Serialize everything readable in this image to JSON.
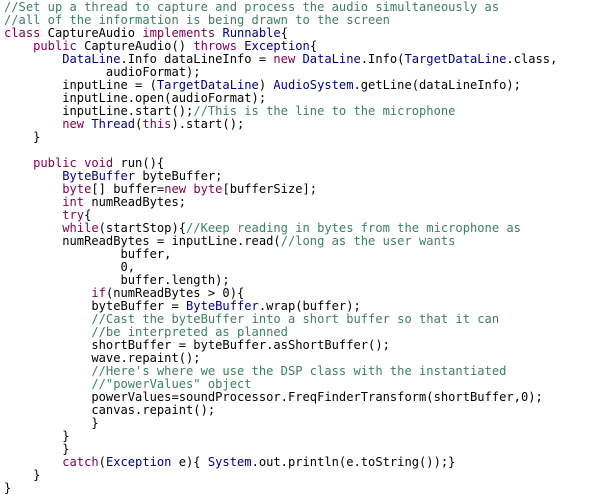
{
  "colors": {
    "background": "#ffffff",
    "plain": "#000000",
    "comment": "#3f7f5f",
    "keyword": "#7f0055",
    "type": "#000080"
  },
  "lines": [
    [
      {
        "s": "c",
        "t": "//Set up a thread to capture and process the audio simultaneously as"
      }
    ],
    [
      {
        "s": "c",
        "t": "//all of the information is being drawn to the screen"
      }
    ],
    [
      {
        "s": "k",
        "t": "class"
      },
      {
        "s": "p",
        "t": " CaptureAudio "
      },
      {
        "s": "k",
        "t": "implements"
      },
      {
        "s": "p",
        "t": " "
      },
      {
        "s": "t",
        "t": "Runnable"
      },
      {
        "s": "p",
        "t": "{"
      }
    ],
    [
      {
        "s": "p",
        "t": "    "
      },
      {
        "s": "k",
        "t": "public"
      },
      {
        "s": "p",
        "t": " CaptureAudio() "
      },
      {
        "s": "k",
        "t": "throws"
      },
      {
        "s": "p",
        "t": " "
      },
      {
        "s": "t",
        "t": "Exception"
      },
      {
        "s": "p",
        "t": "{"
      }
    ],
    [
      {
        "s": "p",
        "t": "        "
      },
      {
        "s": "t",
        "t": "DataLine"
      },
      {
        "s": "p",
        "t": ".Info dataLineInfo = "
      },
      {
        "s": "k",
        "t": "new"
      },
      {
        "s": "p",
        "t": " "
      },
      {
        "s": "t",
        "t": "DataLine"
      },
      {
        "s": "p",
        "t": ".Info("
      },
      {
        "s": "t",
        "t": "TargetDataLine"
      },
      {
        "s": "p",
        "t": ".class,"
      }
    ],
    [
      {
        "s": "p",
        "t": "              audioFormat);"
      }
    ],
    [
      {
        "s": "p",
        "t": "        inputLine = ("
      },
      {
        "s": "t",
        "t": "TargetDataLine"
      },
      {
        "s": "p",
        "t": ") "
      },
      {
        "s": "t",
        "t": "AudioSystem"
      },
      {
        "s": "p",
        "t": ".getLine(dataLineInfo);"
      }
    ],
    [
      {
        "s": "p",
        "t": "        inputLine.open(audioFormat);"
      }
    ],
    [
      {
        "s": "p",
        "t": "        inputLine.start();"
      },
      {
        "s": "c",
        "t": "//This is the line to the microphone"
      }
    ],
    [
      {
        "s": "p",
        "t": "        "
      },
      {
        "s": "k",
        "t": "new"
      },
      {
        "s": "p",
        "t": " "
      },
      {
        "s": "t",
        "t": "Thread"
      },
      {
        "s": "p",
        "t": "("
      },
      {
        "s": "k",
        "t": "this"
      },
      {
        "s": "p",
        "t": ").start();"
      }
    ],
    [
      {
        "s": "p",
        "t": "    }"
      }
    ],
    [
      {
        "s": "p",
        "t": ""
      }
    ],
    [
      {
        "s": "p",
        "t": "    "
      },
      {
        "s": "k",
        "t": "public"
      },
      {
        "s": "p",
        "t": " "
      },
      {
        "s": "k",
        "t": "void"
      },
      {
        "s": "p",
        "t": " run(){"
      }
    ],
    [
      {
        "s": "p",
        "t": "        "
      },
      {
        "s": "t",
        "t": "ByteBuffer"
      },
      {
        "s": "p",
        "t": " byteBuffer;"
      }
    ],
    [
      {
        "s": "p",
        "t": "        "
      },
      {
        "s": "k",
        "t": "byte"
      },
      {
        "s": "p",
        "t": "[] buffer="
      },
      {
        "s": "k",
        "t": "new"
      },
      {
        "s": "p",
        "t": " "
      },
      {
        "s": "k",
        "t": "byte"
      },
      {
        "s": "p",
        "t": "[bufferSize];"
      }
    ],
    [
      {
        "s": "p",
        "t": "        "
      },
      {
        "s": "k",
        "t": "int"
      },
      {
        "s": "p",
        "t": " numReadBytes;"
      }
    ],
    [
      {
        "s": "p",
        "t": "        "
      },
      {
        "s": "k",
        "t": "try"
      },
      {
        "s": "p",
        "t": "{"
      }
    ],
    [
      {
        "s": "p",
        "t": "        "
      },
      {
        "s": "k",
        "t": "while"
      },
      {
        "s": "p",
        "t": "(startStop){"
      },
      {
        "s": "c",
        "t": "//Keep reading in bytes from the microphone as"
      }
    ],
    [
      {
        "s": "p",
        "t": "        numReadBytes = inputLine.read("
      },
      {
        "s": "c",
        "t": "//long as the user wants"
      }
    ],
    [
      {
        "s": "p",
        "t": "                buffer,"
      }
    ],
    [
      {
        "s": "p",
        "t": "                0,"
      }
    ],
    [
      {
        "s": "p",
        "t": "                buffer.length);"
      }
    ],
    [
      {
        "s": "p",
        "t": "            "
      },
      {
        "s": "k",
        "t": "if"
      },
      {
        "s": "p",
        "t": "(numReadBytes > 0){"
      }
    ],
    [
      {
        "s": "p",
        "t": "            byteBuffer = "
      },
      {
        "s": "t",
        "t": "ByteBuffer"
      },
      {
        "s": "p",
        "t": ".wrap(buffer);"
      }
    ],
    [
      {
        "s": "p",
        "t": "            "
      },
      {
        "s": "c",
        "t": "//Cast the byteBuffer into a short buffer so that it can"
      }
    ],
    [
      {
        "s": "p",
        "t": "            "
      },
      {
        "s": "c",
        "t": "//be interpreted as planned"
      }
    ],
    [
      {
        "s": "p",
        "t": "            shortBuffer = byteBuffer.asShortBuffer();"
      }
    ],
    [
      {
        "s": "p",
        "t": "            wave.repaint();"
      }
    ],
    [
      {
        "s": "p",
        "t": "            "
      },
      {
        "s": "c",
        "t": "//Here's where we use the DSP class with the instantiated"
      }
    ],
    [
      {
        "s": "p",
        "t": "            "
      },
      {
        "s": "c",
        "t": "//\"powerValues\" object"
      }
    ],
    [
      {
        "s": "p",
        "t": "            powerValues=soundProcessor.FreqFinderTransform(shortBuffer,0);"
      }
    ],
    [
      {
        "s": "p",
        "t": "            canvas.repaint();"
      }
    ],
    [
      {
        "s": "p",
        "t": "            }"
      }
    ],
    [
      {
        "s": "p",
        "t": "        }"
      }
    ],
    [
      {
        "s": "p",
        "t": "        }"
      }
    ],
    [
      {
        "s": "p",
        "t": "        "
      },
      {
        "s": "k",
        "t": "catch"
      },
      {
        "s": "p",
        "t": "("
      },
      {
        "s": "t",
        "t": "Exception"
      },
      {
        "s": "p",
        "t": " e){ "
      },
      {
        "s": "t",
        "t": "System"
      },
      {
        "s": "p",
        "t": ".out.println(e.toString());}"
      }
    ],
    [
      {
        "s": "p",
        "t": "    }"
      }
    ],
    [
      {
        "s": "p",
        "t": "}"
      }
    ]
  ]
}
